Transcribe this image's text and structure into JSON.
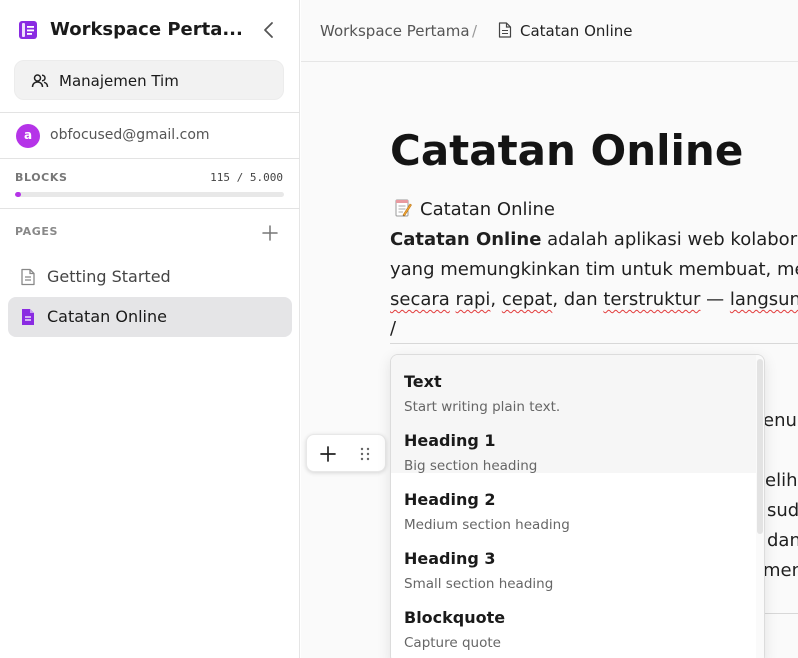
{
  "sidebar": {
    "workspace_title": "Workspace Perta...",
    "team_button_label": "Manajemen Tim",
    "user": {
      "avatar_letter": "a",
      "email": "obfocused@gmail.com"
    },
    "blocks": {
      "label": "BLOCKS",
      "count": "115 / 5.000",
      "usage_fraction": 0.023
    },
    "pages_label": "PAGES",
    "pages": [
      {
        "label": "Getting Started",
        "active": false
      },
      {
        "label": "Catatan Online",
        "active": true
      }
    ]
  },
  "header": {
    "breadcrumb": {
      "workspace": "Workspace Pertama",
      "separator": "/",
      "page": "Catatan Online"
    }
  },
  "document": {
    "title": "Catatan Online",
    "subtitle": "Catatan Online",
    "paragraph": {
      "line1_bold": "Catatan Online",
      "line1_rest": " adalah aplikasi web kolaboras",
      "line2": "yang memungkinkan tim untuk membuat, mer",
      "line3_parts": [
        "secara",
        " ",
        "rapi",
        ", ",
        "cepat",
        ", dan ",
        "terstruktur",
        " — ",
        "langsung"
      ]
    },
    "slash_line": "/",
    "background_fragments": [
      "enu",
      "eliha",
      "sud",
      "dan",
      "men"
    ]
  },
  "slash_menu": {
    "items": [
      {
        "title": "Text",
        "description": "Start writing plain text."
      },
      {
        "title": "Heading 1",
        "description": "Big section heading"
      },
      {
        "title": "Heading 2",
        "description": "Medium section heading"
      },
      {
        "title": "Heading 3",
        "description": "Small section heading"
      },
      {
        "title": "Blockquote",
        "description": "Capture quote"
      }
    ]
  },
  "colors": {
    "accent": "#b534e8",
    "logo": "#8a2be2",
    "spellcheck_underline": "#e23b3b"
  },
  "icons": {
    "workspace_logo": "document-icon",
    "collapse": "chevron-left-icon",
    "team": "users-icon",
    "add_page": "plus-icon",
    "page": "file-icon",
    "memo": "memo-icon",
    "handle_add": "plus-icon",
    "handle_drag": "drag-handle-icon"
  }
}
